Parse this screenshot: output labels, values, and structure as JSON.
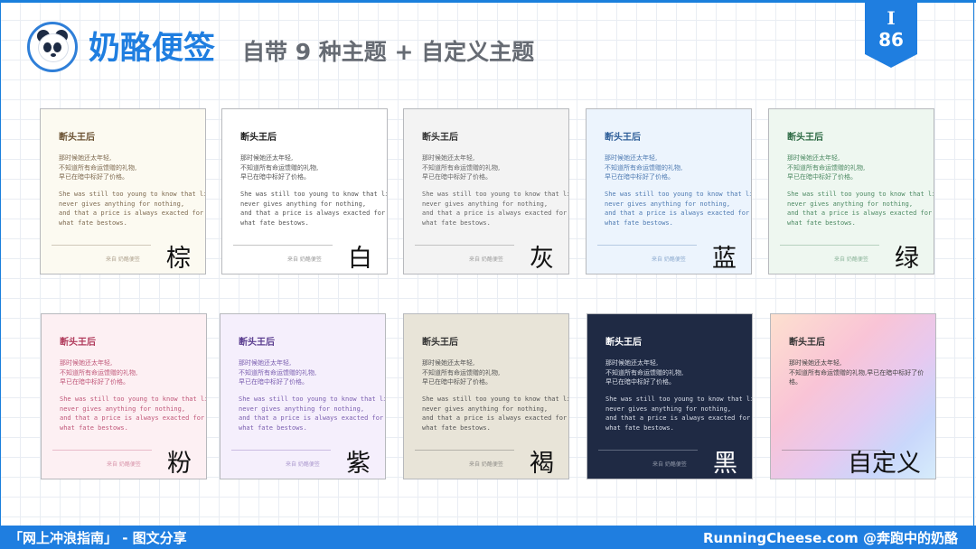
{
  "header": {
    "title": "奶酪便签",
    "subtitle": "自带 9 种主题 + 自定义主题",
    "badge_symbol": "I",
    "badge_number": "86",
    "logo_icon": "panda-logo-icon"
  },
  "note": {
    "title": "断头王后",
    "zh_lines": [
      "那时候她还太年轻,",
      "不知道所有命运馈赠的礼物,",
      "早已在暗中标好了价格。"
    ],
    "zh_one_paragraph_line1": "那时候她还太年轻,",
    "zh_one_paragraph_line2": "不知道所有命运馈赠的礼物,早已在暗中标好了价格。",
    "en_lines": [
      "She was still too young to know that life",
      "never gives anything for nothing,",
      "and that a price is always exacted for",
      "what fate bestows."
    ],
    "source": "来自 奶酪便签"
  },
  "themes": [
    {
      "label": "棕",
      "bg": "#fcfaf1",
      "title_color": "#6b5233",
      "text_color": "#7e6a50"
    },
    {
      "label": "白",
      "bg": "#ffffff",
      "title_color": "#222222",
      "text_color": "#555555"
    },
    {
      "label": "灰",
      "bg": "#f3f3f3",
      "title_color": "#333333",
      "text_color": "#666666"
    },
    {
      "label": "蓝",
      "bg": "#ecf4fd",
      "title_color": "#2f5f99",
      "text_color": "#4f7bb2"
    },
    {
      "label": "绿",
      "bg": "#eef7f0",
      "title_color": "#2e6b45",
      "text_color": "#4d8a63"
    },
    {
      "label": "粉",
      "bg": "#fdf0f3",
      "title_color": "#b03a5b",
      "text_color": "#c0587a"
    },
    {
      "label": "紫",
      "bg": "#f5effc",
      "title_color": "#5a3d8f",
      "text_color": "#7b5fb0"
    },
    {
      "label": "褐",
      "bg": "#e8e4d8",
      "title_color": "#333333",
      "text_color": "#555555"
    },
    {
      "label": "黑",
      "bg": "#1f2a44",
      "title_color": "#ffffff",
      "text_color": "#d8dde8"
    },
    {
      "label": "自定义",
      "bg": "#fbd6c8",
      "title_color": "#333333",
      "text_color": "#444444"
    }
  ],
  "footer": {
    "left": "「网上冲浪指南」 - 图文分享",
    "right": "RunningCheese.com @奔跑中的奶酪"
  }
}
